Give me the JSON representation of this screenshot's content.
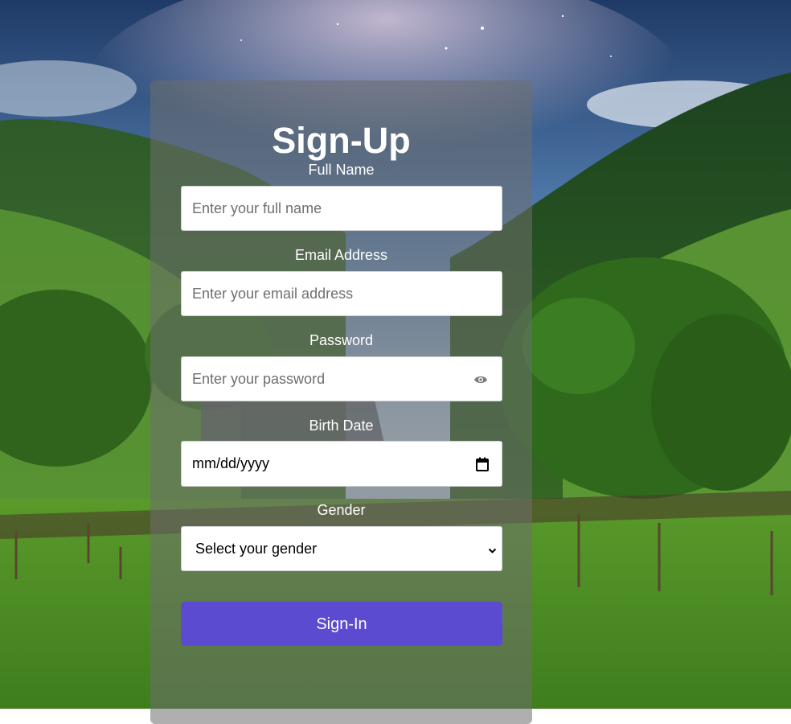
{
  "form": {
    "title": "Sign-Up",
    "full_name": {
      "label": "Full Name",
      "placeholder": "Enter your full name"
    },
    "email": {
      "label": "Email Address",
      "placeholder": "Enter your email address"
    },
    "password": {
      "label": "Password",
      "placeholder": "Enter your password",
      "toggle_icon": "eye-icon"
    },
    "birth_date": {
      "label": "Birth Date",
      "value": "mm/dd/yyyy",
      "icon": "calendar-icon"
    },
    "gender": {
      "label": "Gender",
      "selected": "Select your gender",
      "icon": "chevron-down-icon"
    },
    "submit_label": "Sign-In"
  },
  "colors": {
    "button": "#5a4bd0",
    "card": "rgba(110,110,110,0.55)",
    "text": "#ffffff"
  }
}
